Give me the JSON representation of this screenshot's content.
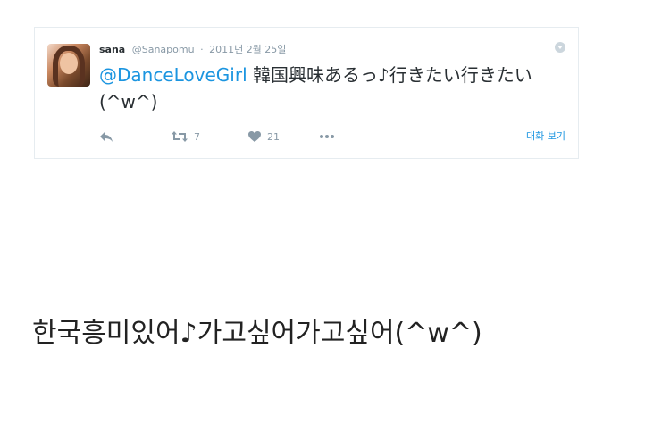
{
  "tweet": {
    "display_name": "sana",
    "handle": "@Sanapomu",
    "separator": "·",
    "date": "2011년 2월 25일",
    "mention": "@DanceLoveGirl",
    "body_text": "韓国興味あるっ♪行きたい行きたい(^w^)",
    "actions": {
      "reply_icon": "reply-icon",
      "retweet_icon": "retweet-icon",
      "retweet_count": "7",
      "like_icon": "heart-icon",
      "like_count": "21",
      "more_icon": "more-dots-icon"
    },
    "view_conversation": "대화 보기"
  },
  "caption": "한국흥미있어♪가고싶어가고싶어(^w^)",
  "colors": {
    "link": "#1b95e0",
    "text": "#292f33",
    "muted": "#8899a6"
  }
}
